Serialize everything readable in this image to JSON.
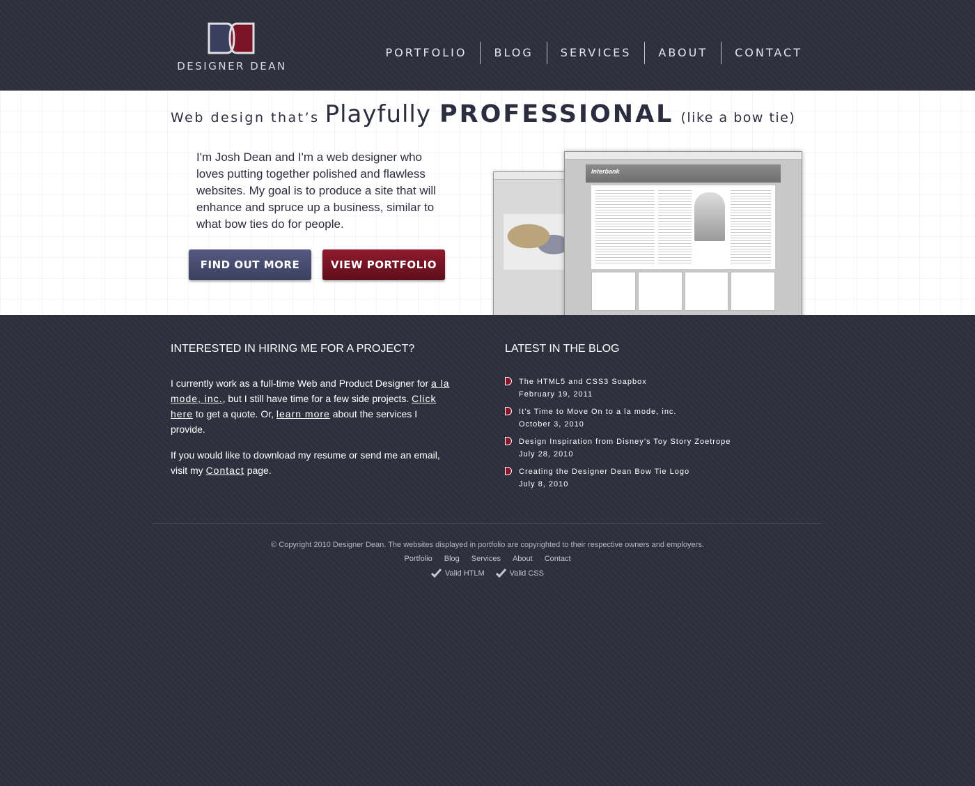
{
  "brand": {
    "name": "DESIGNER DEAN",
    "colors": {
      "navy": "#3b3f5f",
      "maroon": "#7a1426",
      "background": "#2d2f3c"
    }
  },
  "nav": [
    "PORTFOLIO",
    "BLOG",
    "SERVICES",
    "ABOUT",
    "CONTACT"
  ],
  "hero": {
    "tagline_prefix": "Web design that’s",
    "tagline_playfully": "Playfully",
    "tagline_professional": "PROFESSIONAL",
    "tagline_suffix": "(like a bow tie)",
    "intro": "I'm Josh Dean and I'm a web designer who loves putting together polished and flawless websites. My goal is to produce a site that will enhance and spruce up a business, similar to what bow ties do for people.",
    "find_out_more": "FIND OUT MORE",
    "view_portfolio": "VIEW PORTFOLIO",
    "screenshot_logo": "Interbank"
  },
  "hire": {
    "heading": "INTERESTED IN HIRING ME FOR A PROJECT?",
    "p1_before": "I currently work as a full-time Web and Product Designer for ",
    "p1_link": "a la mode, inc.",
    "p1_middle": ", but I still have time for a few side projects. ",
    "p1_click_here": "Click here",
    "p1_middle2": " to get a quote. Or, ",
    "p1_learn_more": "learn more",
    "p1_after": " about the services I provide.",
    "p2_before": "If you would like to download my resume or send me an email, visit my ",
    "p2_link": "Contact",
    "p2_after": " page."
  },
  "blog": {
    "heading": "LATEST IN THE BLOG",
    "posts": [
      {
        "title": "The HTML5 and CSS3 Soapbox",
        "date": "February 19, 2011"
      },
      {
        "title": "It’s Time to Move On to a la mode, inc.",
        "date": "October 3, 2010"
      },
      {
        "title": "Design Inspiration from Disney’s Toy Story Zoetrope",
        "date": "July 28, 2010"
      },
      {
        "title": "Creating the Designer Dean Bow Tie Logo",
        "date": "July 8, 2010"
      }
    ]
  },
  "footer": {
    "copyright": "© Copyright 2010 Designer Dean. The websites displayed in portfolio are copyrighted to their respective owners and employers.",
    "links": [
      "Portfolio",
      "Blog",
      "Services",
      "About",
      "Contact"
    ],
    "valid_html": "Valid HTLM",
    "valid_css": "Valid CSS"
  }
}
